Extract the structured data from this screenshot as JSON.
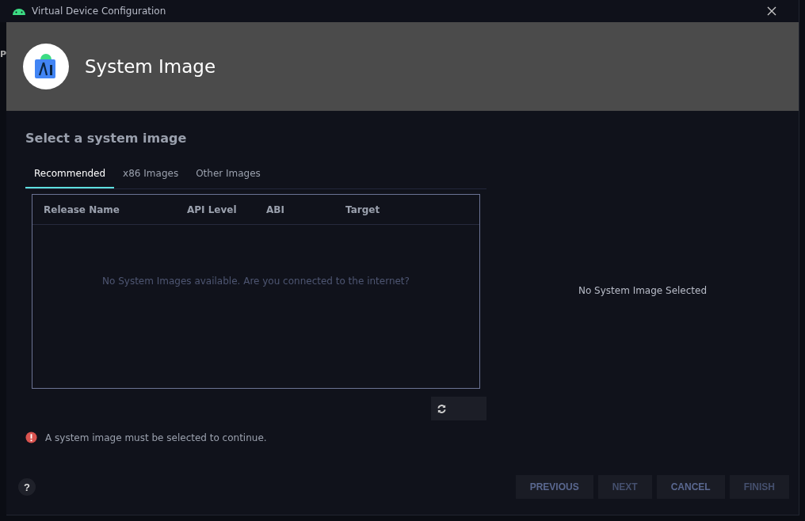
{
  "window": {
    "title": "Virtual Device Configuration"
  },
  "background_fragment": "P",
  "header": {
    "title": "System Image"
  },
  "section_title": "Select a system image",
  "tabs": [
    {
      "label": "Recommended",
      "selected": true
    },
    {
      "label": "x86 Images",
      "selected": false
    },
    {
      "label": "Other Images",
      "selected": false
    }
  ],
  "table": {
    "columns": [
      "Release Name",
      "API Level",
      "ABI",
      "Target"
    ],
    "empty_message": "No System Images available. Are you connected to the internet?"
  },
  "details": {
    "message": "No System Image Selected"
  },
  "error": "A system image must be selected to continue.",
  "help": "?",
  "buttons": [
    {
      "label": "PREVIOUS",
      "disabled": false
    },
    {
      "label": "NEXT",
      "disabled": true
    },
    {
      "label": "CANCEL",
      "disabled": false
    },
    {
      "label": "FINISH",
      "disabled": true
    }
  ]
}
